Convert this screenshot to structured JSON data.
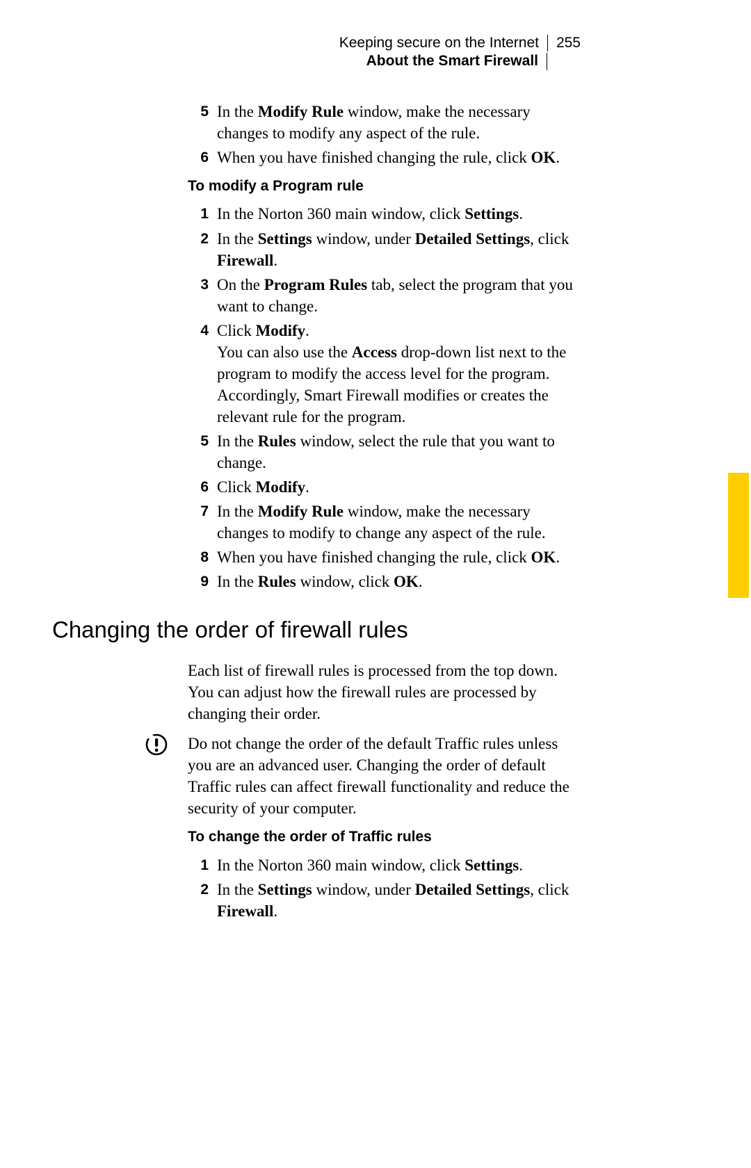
{
  "header": {
    "chapter_title": "Keeping secure on the Internet",
    "page_number": "255",
    "subtitle": "About the Smart Firewall"
  },
  "top_list": [
    {
      "num": "5",
      "parts": [
        "In the ",
        "Modify Rule",
        " window, make the necessary changes to modify any aspect of the rule."
      ]
    },
    {
      "num": "6",
      "parts": [
        "When you have finished changing the rule, click ",
        "OK",
        "."
      ]
    }
  ],
  "subheading1": "To modify a Program rule",
  "program_rule_list": [
    {
      "num": "1",
      "parts": [
        "In the Norton 360 main window, click ",
        "Settings",
        "."
      ]
    },
    {
      "num": "2",
      "parts": [
        "In the ",
        "Settings",
        " window, under ",
        "Detailed Settings",
        ", click ",
        "Firewall",
        "."
      ]
    },
    {
      "num": "3",
      "parts": [
        "On the ",
        "Program Rules",
        " tab, select the program that you want to change."
      ]
    },
    {
      "num": "4",
      "parts": [
        "Click ",
        "Modify",
        "."
      ],
      "extra": [
        "You can also use the ",
        "Access",
        " drop-down list next to the program to modify the access level for the program. Accordingly, Smart Firewall modifies or creates the relevant rule for the program."
      ]
    },
    {
      "num": "5",
      "parts": [
        "In the ",
        "Rules",
        " window, select the rule that you want to change."
      ]
    },
    {
      "num": "6",
      "parts": [
        "Click ",
        "Modify",
        "."
      ]
    },
    {
      "num": "7",
      "parts": [
        "In the ",
        "Modify Rule",
        " window, make the necessary changes to modify to change any aspect of the rule."
      ]
    },
    {
      "num": "8",
      "parts": [
        "When you have finished changing the rule, click ",
        "OK",
        "."
      ]
    },
    {
      "num": "9",
      "parts": [
        "In the ",
        "Rules",
        " window, click ",
        "OK",
        "."
      ]
    }
  ],
  "section_heading": "Changing the order of firewall rules",
  "para1": "Each list of firewall rules is processed from the top down. You can adjust how the firewall rules are processed by changing their order.",
  "warning_para": "Do not change the order of the default Traffic rules unless you are an advanced user. Changing the order of default Traffic rules can affect firewall functionality and reduce the security of your computer.",
  "subheading2": "To change the order of Traffic rules",
  "traffic_rule_list": [
    {
      "num": "1",
      "parts": [
        "In the Norton 360 main window, click ",
        "Settings",
        "."
      ]
    },
    {
      "num": "2",
      "parts": [
        "In the ",
        "Settings",
        " window, under ",
        "Detailed Settings",
        ", click ",
        "Firewall",
        "."
      ]
    }
  ]
}
